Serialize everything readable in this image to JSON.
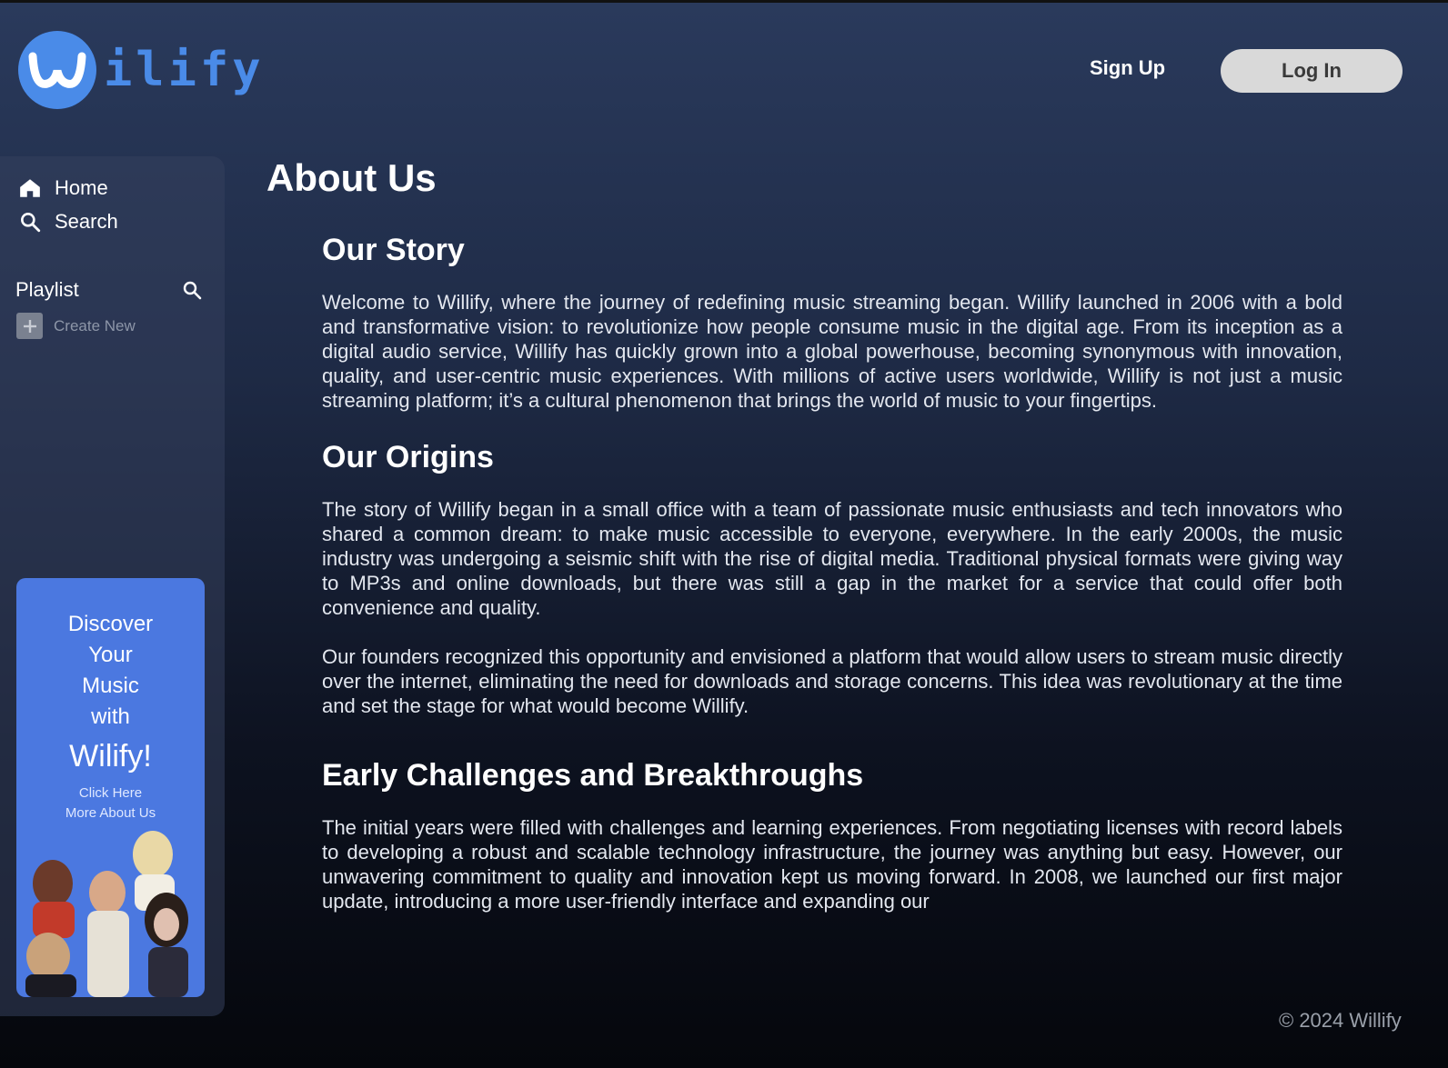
{
  "brand": {
    "logo_text": "ilify",
    "accent": "#4a8be8"
  },
  "header": {
    "signup_label": "Sign Up",
    "login_label": "Log In"
  },
  "sidebar": {
    "nav": [
      {
        "label": "Home",
        "icon": "home-icon"
      },
      {
        "label": "Search",
        "icon": "search-icon"
      }
    ],
    "playlist_label": "Playlist",
    "create_new_label": "Create New",
    "promo": {
      "line1": "Discover",
      "line2": "Your",
      "line3": "Music",
      "line4": "with",
      "brand": "Wilify!",
      "cta1": "Click Here",
      "cta2": "More About Us"
    }
  },
  "main": {
    "title": "About Us",
    "sections": [
      {
        "heading": "Our Story",
        "paragraphs": [
          "Welcome to Willify, where the journey of redefining music streaming began. Willify launched in 2006 with a bold and transformative vision: to revolutionize how people consume music in the digital age. From its inception as a digital audio service, Willify has quickly grown into a global powerhouse, becoming synonymous with innovation, quality, and user-centric music experiences. With millions of active users worldwide, Willify is not just a music streaming platform; it’s a cultural phenomenon that brings the world of music to your fingertips."
        ]
      },
      {
        "heading": "Our Origins",
        "paragraphs": [
          "The story of Willify began in a small office with a team of passionate music enthusiasts and tech innovators who shared a common dream: to make music accessible to everyone, everywhere. In the early 2000s, the music industry was undergoing a seismic shift with the rise of digital media. Traditional physical formats were giving way to MP3s and online downloads, but there was still a gap in the market for a service that could offer both convenience and quality.",
          "Our founders recognized this opportunity and envisioned a platform that would allow users to stream music directly over the internet, eliminating the need for downloads and storage concerns. This idea was revolutionary at the time and set the stage for what would become Willify."
        ]
      },
      {
        "heading": "Early Challenges and Breakthroughs",
        "paragraphs": [
          "The initial years were filled with challenges and learning experiences. From negotiating licenses with record labels to developing a robust and scalable technology infrastructure, the journey was anything but easy. However, our unwavering commitment to quality and innovation kept us moving forward. In 2008, we launched our first major update, introducing a more user-friendly interface and expanding our"
        ]
      }
    ]
  },
  "footer": {
    "copyright": "© 2024 Willify"
  }
}
